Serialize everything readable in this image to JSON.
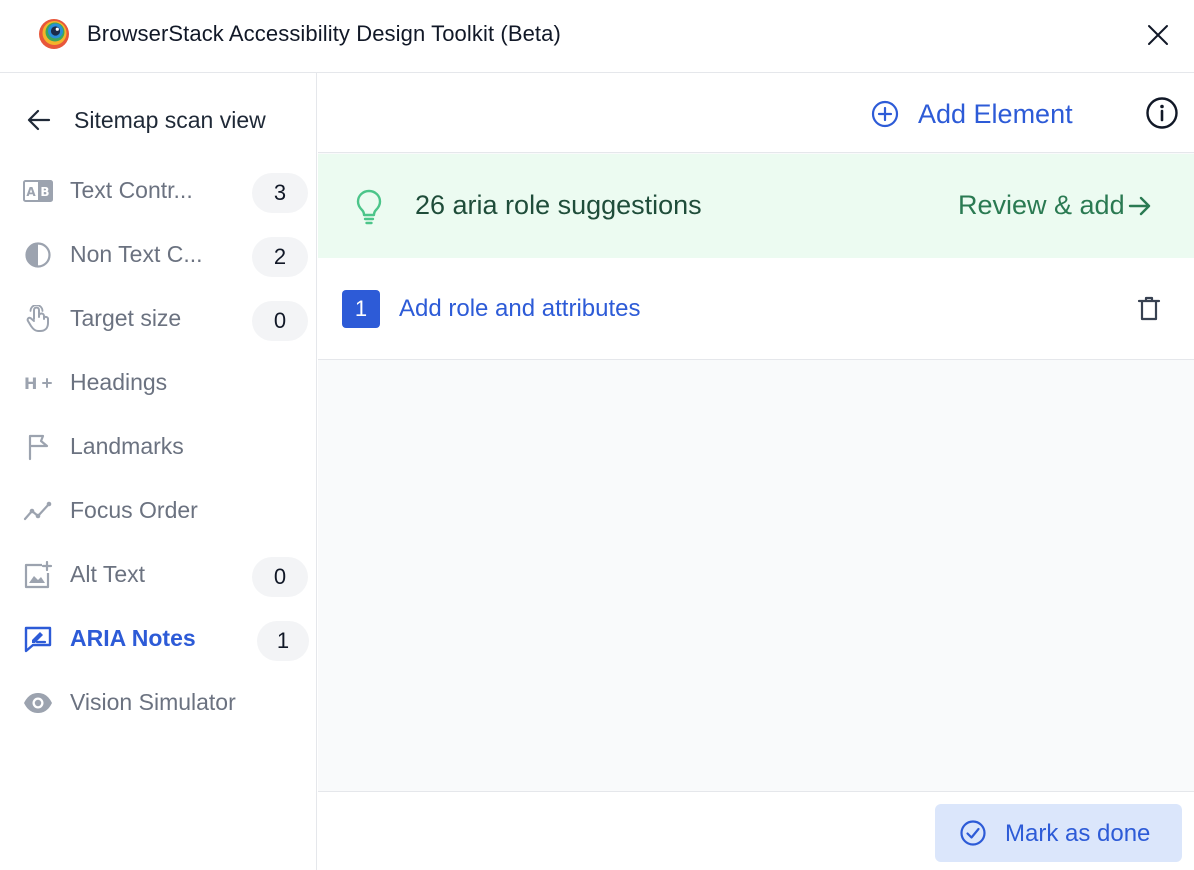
{
  "window": {
    "title": "BrowserStack Accessibility Design Toolkit (Beta)"
  },
  "sidebar": {
    "back_label": "Sitemap scan view",
    "items": [
      {
        "label": "Text Contr...",
        "badge": "3",
        "icon": "text-contrast-icon"
      },
      {
        "label": "Non Text C...",
        "badge": "2",
        "icon": "non-text-contrast-icon"
      },
      {
        "label": "Target size",
        "badge": "0",
        "icon": "touch-target-icon"
      },
      {
        "label": "Headings",
        "badge": "",
        "icon": "headings-icon"
      },
      {
        "label": "Landmarks",
        "badge": "",
        "icon": "landmark-flag-icon"
      },
      {
        "label": "Focus Order",
        "badge": "",
        "icon": "focus-order-icon"
      },
      {
        "label": "Alt Text",
        "badge": "0",
        "icon": "alt-text-image-icon"
      },
      {
        "label": "ARIA Notes",
        "badge": "1",
        "icon": "aria-notes-icon",
        "active": true
      },
      {
        "label": "Vision Simulator",
        "badge": "",
        "icon": "eye-icon"
      }
    ]
  },
  "toolbar": {
    "add_element_label": "Add Element"
  },
  "suggestions": {
    "text": "26 aria role suggestions",
    "review_label": "Review & add"
  },
  "elements": [
    {
      "index": "1",
      "label": "Add role and attributes"
    }
  ],
  "footer": {
    "mark_done_label": "Mark as done"
  },
  "colors": {
    "accent": "#2d5bd7",
    "banner_bg": "#ecfbf1",
    "banner_link": "#2a7a52",
    "muted_text": "#6b7280"
  }
}
